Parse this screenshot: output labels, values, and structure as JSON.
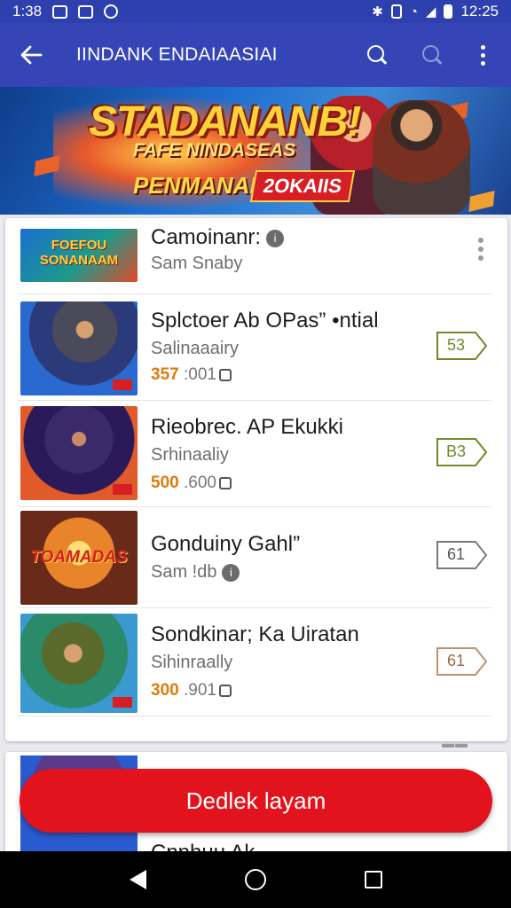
{
  "status_bar": {
    "time": "1:38",
    "clock_right": "12:25"
  },
  "app_bar": {
    "title": "IINDANK ENDAIAASIAI"
  },
  "banner": {
    "title": "STADANANB!",
    "subtitle": "FAFE NINDASEAS",
    "tag_left": "PENMANAINT",
    "tag_right": "2OKAIIS"
  },
  "list": [
    {
      "title": "Camoinanr:",
      "subtitle": "Sam Snaby",
      "meta_price": "",
      "meta_rest": "",
      "badge": "",
      "thumb_text": "FOEFOU SONANAAM",
      "has_info": true,
      "has_menu": true
    },
    {
      "title": "Splctoer Ab OPas” •ntial",
      "subtitle": "Salinaaairy",
      "meta_price": "357",
      "meta_rest": ":001",
      "badge": "53",
      "badge_color": "#6f8a2a",
      "thumb_text": ""
    },
    {
      "title": "Rieobrec. AP Ekukki",
      "subtitle": "Srhinaaliy",
      "meta_price": "500",
      "meta_rest": ".600",
      "badge": "B3",
      "badge_color": "#6f8a2a",
      "thumb_text": ""
    },
    {
      "title": "Gonduiny Gahl”",
      "subtitle": "Sam !db",
      "meta_price": "",
      "meta_rest": "",
      "badge": "61",
      "badge_color": "#7a7a7a",
      "thumb_text": "TOAMADAS",
      "has_info": true
    },
    {
      "title": "Sondkinar; Ka Uiratan",
      "subtitle": "Sihinraally",
      "meta_price": "300",
      "meta_rest": ".901",
      "badge": "61",
      "badge_color": "#b98a6a",
      "thumb_text": ""
    }
  ],
  "next_card": {
    "title": "Cnnhuu Ak"
  },
  "cta": {
    "label": "Dedlek layam"
  },
  "colors": {
    "app_bar": "#3545b6",
    "cta": "#e2131c",
    "price": "#e07b0c"
  }
}
